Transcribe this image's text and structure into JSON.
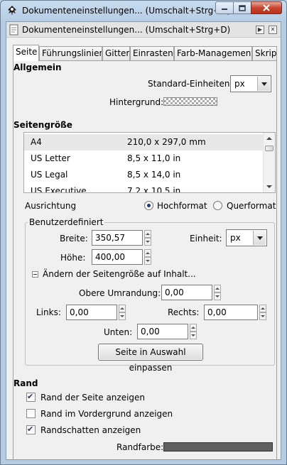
{
  "window": {
    "title": "Dokumenteneinstellungen... (Umschalt+Strg+D)",
    "close_color": "#c7452f"
  },
  "dock": {
    "title": "Dokumenteneinstellungen... (Umschalt+Strg+D)"
  },
  "tabs": [
    {
      "label": "Seite",
      "active": true
    },
    {
      "label": "Führungslinien",
      "active": false
    },
    {
      "label": "Gitter",
      "active": false
    },
    {
      "label": "Einrasten",
      "active": false
    },
    {
      "label": "Farb-Management",
      "active": false
    },
    {
      "label": "Skripte",
      "active": false
    }
  ],
  "general": {
    "heading": "Allgemein",
    "units_label": "Standard-Einheiten:",
    "units_value": "px",
    "background_label": "Hintergrund:"
  },
  "page_size": {
    "heading": "Seitengröße",
    "rows": [
      {
        "name": "A4",
        "size": "210,0 x 297,0 mm",
        "selected": true
      },
      {
        "name": "US Letter",
        "size": "8,5 x 11,0 in",
        "selected": false
      },
      {
        "name": "US Legal",
        "size": "8,5 x 14,0 in",
        "selected": false
      },
      {
        "name": "US Executive",
        "size": "7,2 x 10,5 in",
        "selected": false
      }
    ],
    "orientation_label": "Ausrichtung",
    "portrait_label": "Hochformat",
    "landscape_label": "Querformat",
    "orientation_value": "Hochformat"
  },
  "custom": {
    "title": "Benutzerdefiniert",
    "width_label": "Breite:",
    "width_value": "350,57",
    "height_label": "Höhe:",
    "height_value": "400,00",
    "unit_label": "Einheit:",
    "unit_value": "px",
    "resize_label": "Ändern der Seitengröße auf Inhalt...",
    "top_margin_label": "Obere Umrandung:",
    "top_margin_value": "0,00",
    "left_label": "Links:",
    "left_value": "0,00",
    "right_label": "Rechts:",
    "right_value": "0,00",
    "bottom_label": "Unten:",
    "bottom_value": "0,00",
    "fit_button": "Seite in Auswahl einpassen"
  },
  "border": {
    "heading": "Rand",
    "show_border_label": "Rand der Seite anzeigen",
    "show_border_checked": true,
    "on_top_label": "Rand im Vordergrund anzeigen",
    "on_top_checked": false,
    "shadow_label": "Randschatten anzeigen",
    "shadow_checked": true,
    "color_label": "Randfarbe:",
    "color_value": "#606060"
  }
}
